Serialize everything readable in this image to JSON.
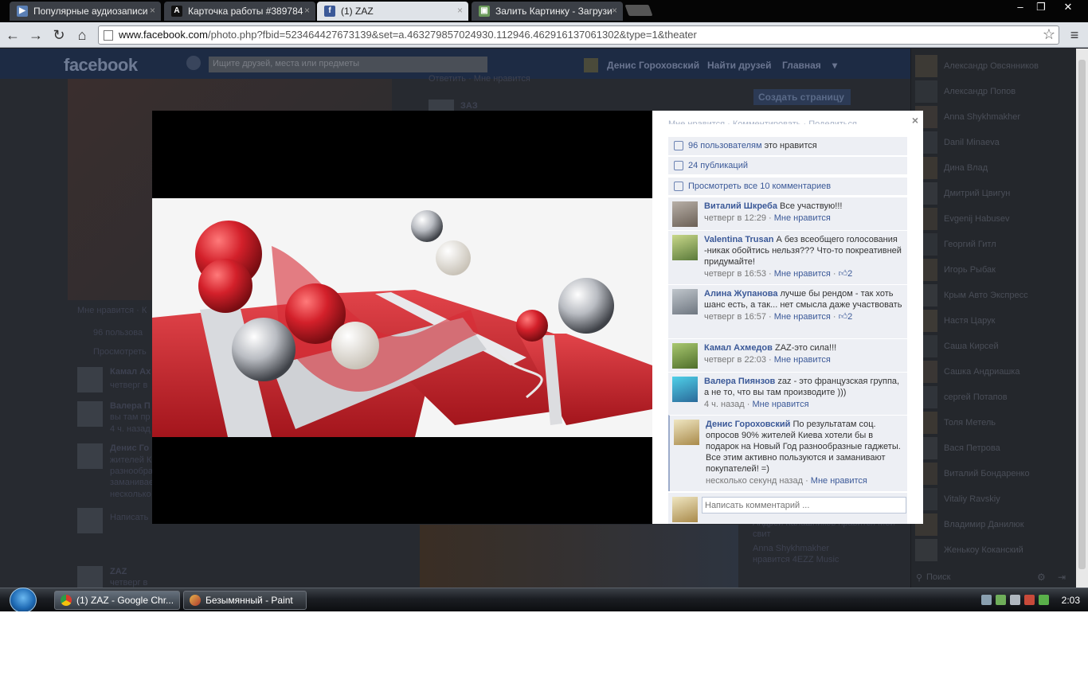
{
  "browser": {
    "tabs": [
      {
        "title": "Популярные аудиозаписи",
        "icon": "play-icon",
        "active": false
      },
      {
        "title": "Карточка работы #389784",
        "icon": "a-icon",
        "active": false
      },
      {
        "title": "(1) ZAZ",
        "icon": "facebook-icon",
        "active": true
      },
      {
        "title": "Залить Картинку - Загрузи",
        "icon": "image-upload-icon",
        "active": false
      }
    ],
    "url_host": "www.facebook.com",
    "url_path": "/photo.php?fbid=523464427673139&set=a.463279857024930.112946.462916137061302&type=1&theater",
    "window_controls": {
      "minimize": "–",
      "restore": "❐",
      "close": "✕"
    }
  },
  "fb_page": {
    "logo": "facebook",
    "search_placeholder": "Ищите друзей, места или предметы",
    "nav": {
      "user": "Денис Гороховский",
      "find_friends": "Найти друзей",
      "home": "Главная"
    },
    "create_page": "Создать страницу",
    "bg_texts": {
      "replies": "Ответить · Мне нравится",
      "zaz_top": "ЗАЗ",
      "likes": "Мне нравится · К",
      "people": "96 пользова",
      "view": "Просмотреть",
      "c1": "Камал Ах",
      "c1b": "четверг в",
      "c2": "Валера П",
      "c2b": "вы там пр",
      "c2c": "4 ч. назад",
      "c3": "Денис Го",
      "c3b": "жителей К",
      "c3c": "разнообра",
      "c3d": "заманивае",
      "c3e": "несколько",
      "write": "Написать",
      "zaz_bottom": "ZAZ",
      "thu": "четверг в",
      "right1": "Андрей Калашников нравится Мой",
      "right2": "свит",
      "right3": "Anna Shykhmakher",
      "right4": "нравится 4EZZ Music"
    }
  },
  "chat": {
    "friends": [
      "Александр Овсянников",
      "Александр Попов",
      "Anna Shykhmakher",
      "Danil Minaeva",
      "Дина Влад",
      "Дмитрий Цвигун",
      "Evgenij Habusev",
      "Георгий Гитл",
      "Игорь Рыбак",
      "Крым Авто Экспресс",
      "Настя Царук",
      "Саша Кирсей",
      "Сашка Андриашка",
      "сергей Потапов",
      "Толя Метель",
      "Вася Петрова",
      "Виталий Бондаренко",
      "Vitaliy Ravskiy",
      "Владимир Данилюк",
      "Женькоу Коканский"
    ],
    "search_placeholder": "Поиск"
  },
  "theater": {
    "close": "×",
    "cut_text": "Мне нравится · Комментировать · Поделиться",
    "likes": {
      "link": "96 пользователям",
      "text": " это нравится"
    },
    "shares": "24 публикаций",
    "view_all": "Просмотреть все 10 комментариев",
    "comments": [
      {
        "author": "Виталий Шкреба",
        "text": "Все участвую!!!",
        "time": "четверг в 12:29",
        "like": "Мне нравится",
        "likes_count": ""
      },
      {
        "author": "Valentina Trusan",
        "text": "А без всеобщего голосования -никак обойтись нельзя??? Что-то покреативней придумайте!",
        "time": "четверг в 16:53",
        "like": "Мне нравится",
        "likes_count": "2"
      },
      {
        "author": "Алина Жупанова",
        "text": "лучше бы рендом - так хоть шанс есть, а так... нет смысла даже участвовать",
        "time": "четверг в 16:57",
        "like": "Мне нравится",
        "likes_count": "2"
      },
      {
        "author": "Камал Ахмедов",
        "text": "ZAZ-это сила!!!",
        "time": "четверг в 22:03",
        "like": "Мне нравится",
        "likes_count": ""
      },
      {
        "author": "Валера Пиянзов",
        "text": "zaz - это французская группа, а не то, что вы там производите )))",
        "time": "4 ч. назад",
        "like": "Мне нравится",
        "likes_count": ""
      },
      {
        "author": "Денис Гороховский",
        "text": "По результатам соц. опросов 90% жителей Киева хотели бы в подарок на Новый Год разнообразные гаджеты. Все этим активно пользуются и заманивают покупателей! =)",
        "time": "несколько секунд назад",
        "like": "Мне нравится",
        "likes_count": ""
      }
    ],
    "compose_placeholder": "Написать комментарий ..."
  },
  "taskbar": {
    "items": [
      {
        "label": "(1) ZAZ - Google Chr...",
        "icon": "chrome-icon"
      },
      {
        "label": "Безымянный - Paint",
        "icon": "paint-icon"
      }
    ],
    "clock": "2:03"
  },
  "colors": {
    "fb_blue": "#3b5998",
    "ufi_bg": "#edeff4",
    "photo_red": "#c9232e"
  }
}
